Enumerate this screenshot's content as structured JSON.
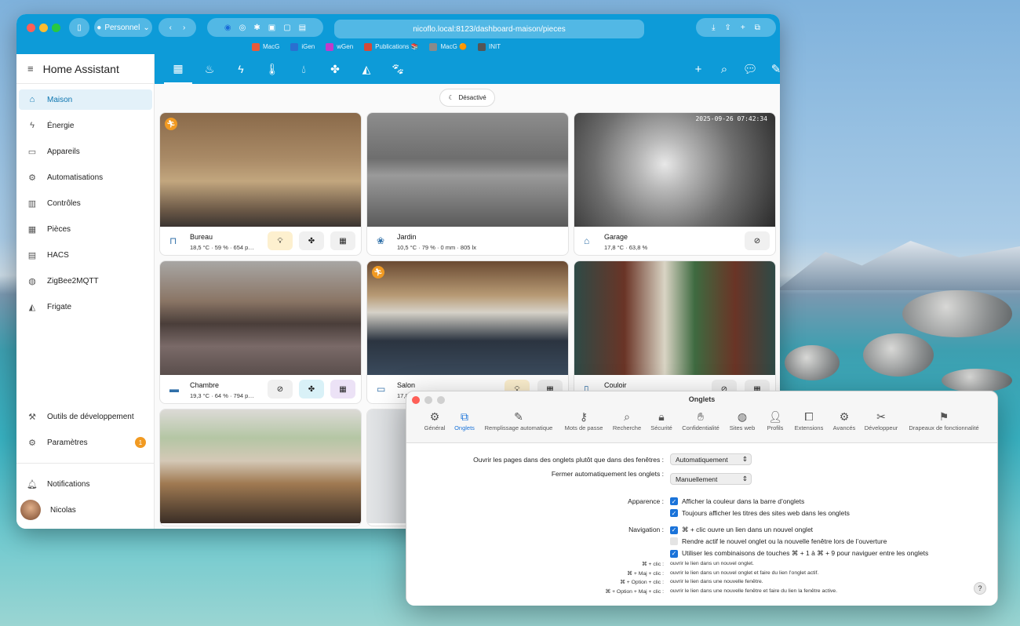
{
  "browser": {
    "profile": "Personnel",
    "url": "nicoflo.local:8123/dashboard-maison/pieces",
    "favorites": [
      {
        "label": "MacG",
        "color": "#e85a3a"
      },
      {
        "label": "iGen",
        "color": "#2a6fd0"
      },
      {
        "label": "wGen",
        "color": "#c23ac9"
      },
      {
        "label": "Publications 📚",
        "color": "#d34a3a"
      },
      {
        "label": "MacG 🟠",
        "color": "#8a8a8a"
      },
      {
        "label": "INIT",
        "color": "#555555"
      }
    ]
  },
  "sidebar": {
    "title": "Home Assistant",
    "items": [
      {
        "label": "Maison",
        "icon": "home-icon"
      },
      {
        "label": "Énergie",
        "icon": "lightning-icon"
      },
      {
        "label": "Appareils",
        "icon": "devices-icon"
      },
      {
        "label": "Automatisations",
        "icon": "robot-icon"
      },
      {
        "label": "Contrôles",
        "icon": "controls-icon"
      },
      {
        "label": "Pièces",
        "icon": "rooms-icon"
      },
      {
        "label": "HACS",
        "icon": "hacs-icon"
      },
      {
        "label": "ZigBee2MQTT",
        "icon": "zigbee-icon"
      },
      {
        "label": "Frigate",
        "icon": "cctv-icon"
      }
    ],
    "dev_tools": "Outils de développement",
    "settings": "Paramètres",
    "settings_badge": "1",
    "notifications": "Notifications",
    "user": "Nicolas"
  },
  "dashboard": {
    "chip": "Désactivé",
    "cards": [
      {
        "name": "Bureau",
        "stats": "18,5 °C · 59 % · 654 p…",
        "photo": "office"
      },
      {
        "name": "Jardin",
        "stats": "10,5 °C · 79 % · 0 mm · 805 lx",
        "photo": "garden"
      },
      {
        "name": "Garage",
        "stats": "17,8 °C · 63,8 %",
        "photo": "garage",
        "overlay": "2025-09-26 07:42:34"
      },
      {
        "name": "Chambre",
        "stats": "19,3 °C · 64 % · 794 p…",
        "photo": "bedroom"
      },
      {
        "name": "Salon",
        "stats": "17,8",
        "photo": "living"
      },
      {
        "name": "Couloir",
        "stats": "",
        "photo": "hallway"
      },
      {
        "name": "",
        "stats": "",
        "photo": "kitchen"
      },
      {
        "name": "",
        "stats": "",
        "photo": "laundry"
      }
    ]
  },
  "prefs": {
    "title": "Onglets",
    "tabs": [
      "Général",
      "Onglets",
      "Remplissage automatique",
      "Mots de passe",
      "Recherche",
      "Sécurité",
      "Confidentialité",
      "Sites web",
      "Profils",
      "Extensions",
      "Avancés",
      "Développeur",
      "Drapeaux de fonctionnalité"
    ],
    "open_pages_label": "Ouvrir les pages dans des onglets plutôt que dans des fenêtres :",
    "open_pages_value": "Automatiquement",
    "close_tabs_label": "Fermer automatiquement les onglets :",
    "close_tabs_value": "Manuellement",
    "appearance_label": "Apparence :",
    "appearance_1": "Afficher la couleur dans la barre d’onglets",
    "appearance_2": "Toujours afficher les titres des sites web dans les onglets",
    "navigation_label": "Navigation :",
    "nav_1": "⌘ + clic ouvre un lien dans un nouvel onglet",
    "nav_2": "Rendre actif le nouvel onglet ou la nouvelle fenêtre lors de l’ouverture",
    "nav_3": "Utiliser les combinaisons de touches ⌘ + 1 à ⌘ + 9 pour naviguer entre les onglets",
    "shortcuts": [
      {
        "k": "⌘ + clic :",
        "v": "ouvrir le lien dans un nouvel onglet."
      },
      {
        "k": "⌘ + Maj + clic :",
        "v": "ouvrir le lien dans un nouvel onglet et faire du lien l’onglet actif."
      },
      {
        "k": "⌘ + Option + clic :",
        "v": "ouvrir le lien dans une nouvelle fenêtre."
      },
      {
        "k": "⌘ + Option + Maj + clic :",
        "v": "ouvrir le lien dans une nouvelle fenêtre et faire du lien la fenêtre active."
      }
    ],
    "help": "?"
  }
}
